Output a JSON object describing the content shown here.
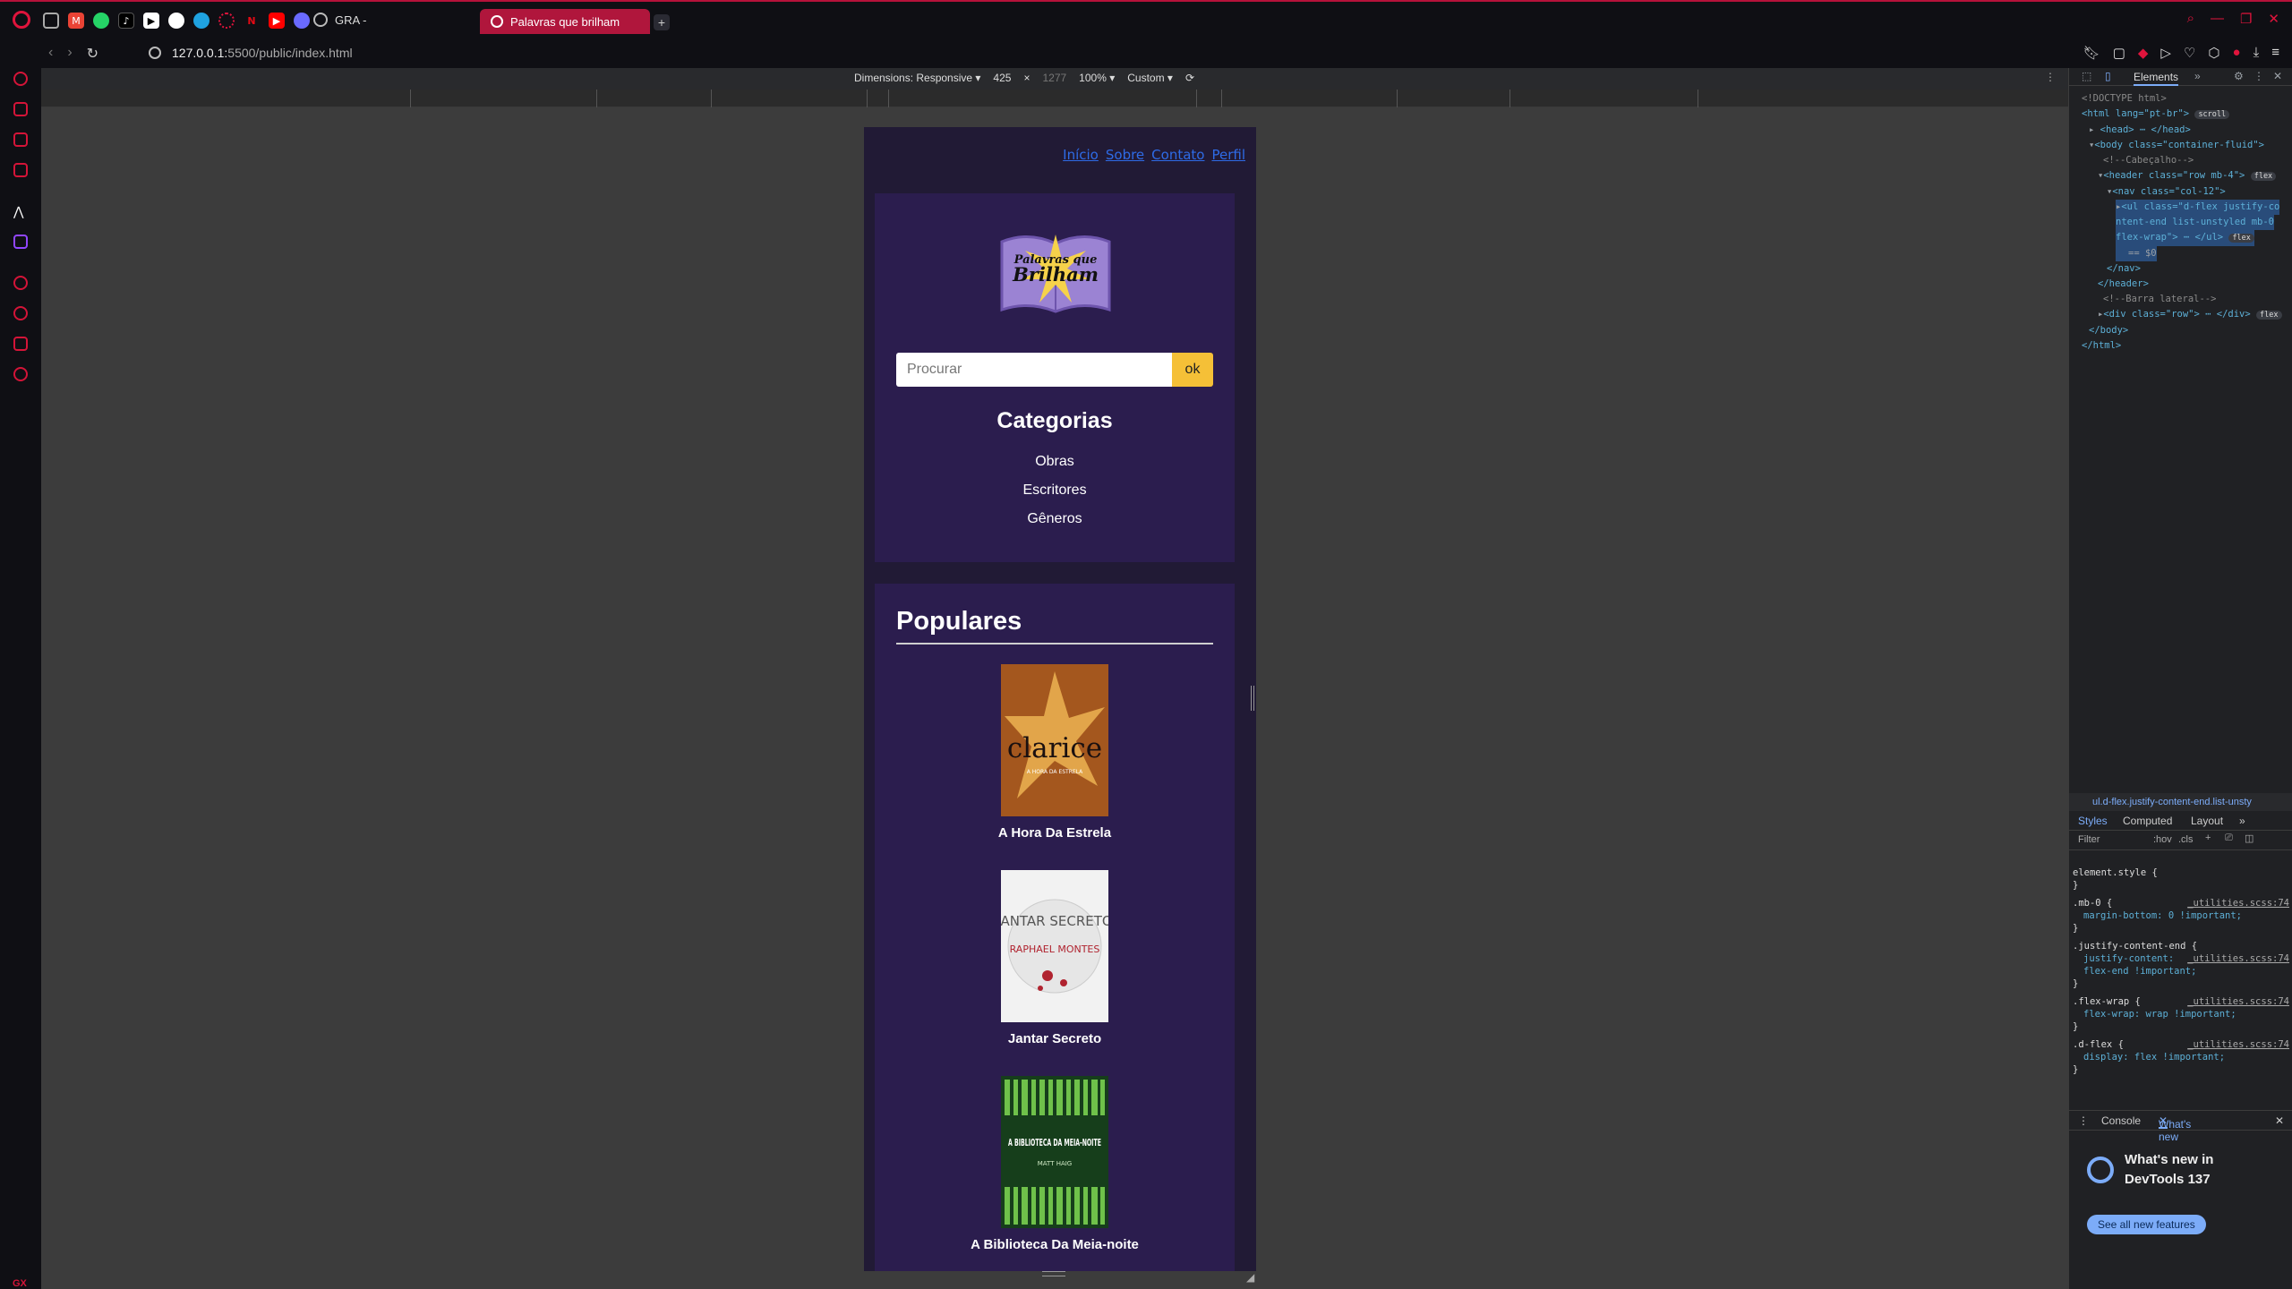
{
  "browser": {
    "gra_tab_label": "GRA -",
    "active_tab_title": "Palavras que brilham",
    "url_host": "127.0.0.1:",
    "url_rest": "5500/public/index.html",
    "accent": "#e0143c"
  },
  "device_toolbar": {
    "dimensions_label": "Dimensions: Responsive",
    "width_value": "425",
    "times": "×",
    "height_value": "1277",
    "zoom": "100%",
    "throttle": "Custom"
  },
  "site": {
    "nav": [
      "Início",
      "Sobre",
      "Contato",
      "Perfil"
    ],
    "logo_line1": "Palavras que",
    "logo_line2": "Brilham",
    "search_placeholder": "Procurar",
    "search_button": "ok",
    "categories_title": "Categorias",
    "categories": [
      "Obras",
      "Escritores",
      "Gêneros"
    ],
    "popular_title": "Populares",
    "books": [
      {
        "title": "A Hora Da Estrela",
        "cover_text": "clarice",
        "cover_sub": "A HORA DA ESTRELA"
      },
      {
        "title": "Jantar Secreto",
        "cover_text": "JANTAR SECRETO",
        "cover_sub": "RAPHAEL MONTES"
      },
      {
        "title": "A Biblioteca Da Meia-noite",
        "cover_text": "A BIBLIOTECA DA MEIA-NOITE",
        "cover_sub": "MATT HAIG"
      }
    ],
    "colors": {
      "page_bg": "#211a35",
      "card_bg": "#2b1d4e",
      "button": "#f5c037",
      "link": "#2e6be6"
    }
  },
  "devtools": {
    "panel_tab": "Elements",
    "dom": {
      "doctype": "<!DOCTYPE html>",
      "html_open": "<html lang=\"pt-br\">",
      "scroll_badge": "scroll",
      "head": "<head> ⋯ </head>",
      "body_open": "<body class=\"container-fluid\">",
      "comment_header": "<!--Cabeçalho-->",
      "header_open": "<header class=\"row mb-4\">",
      "flex_badge": "flex",
      "nav_open": "<nav class=\"col-12\">",
      "ul_line1": "<ul class=\"d-flex justify-co",
      "ul_line2": "ntent-end list-unstyled mb-0",
      "ul_line3": "flex-wrap\"> ⋯ </ul>",
      "eq_line": "== $0",
      "nav_close": "</nav>",
      "header_close": "</header>",
      "comment_sidebar": "<!--Barra lateral-->",
      "div_row": "<div class=\"row\"> ⋯ </div>",
      "body_close": "</body>",
      "html_close": "</html>"
    },
    "breadcrumb": "ul.d-flex.justify-content-end.list-unsty",
    "styles_tabs": [
      "Styles",
      "Computed",
      "Layout"
    ],
    "filter_placeholder": "Filter",
    "hov": ":hov",
    "cls": ".cls",
    "rules": [
      {
        "selector": "element.style {",
        "file": "",
        "props": [],
        "close": "}"
      },
      {
        "selector": ".mb-0 {",
        "file": "_utilities.scss:74",
        "props": [
          "margin-bottom: 0 !important;"
        ],
        "close": "}"
      },
      {
        "selector": ".justify-content-end {",
        "file": "_utilities.scss:74",
        "props": [
          "justify-content: flex-end !important;"
        ],
        "close": "}"
      },
      {
        "selector": ".flex-wrap {",
        "file": "_utilities.scss:74",
        "props": [
          "flex-wrap: wrap !important;"
        ],
        "close": "}"
      },
      {
        "selector": ".d-flex {",
        "file": "_utilities.scss:74",
        "props": [
          "display: flex !important;"
        ],
        "close": "}"
      }
    ],
    "drawer_tabs": [
      "Console",
      "What's new"
    ],
    "whats_new_title_1": "What's new in",
    "whats_new_title_2": "DevTools 137",
    "see_all": "See all new features"
  }
}
